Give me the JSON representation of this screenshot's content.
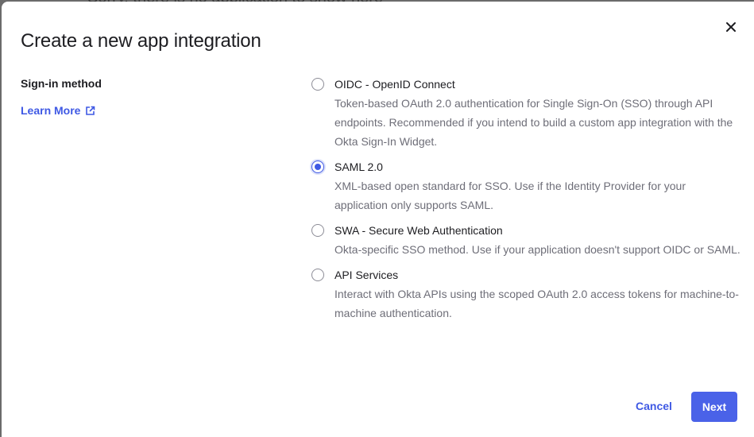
{
  "backdrop": {
    "text": "Sorry, there is no application to show here"
  },
  "dialog": {
    "title": "Create a new app integration",
    "section_label": "Sign-in method",
    "learn_more_label": "Learn More",
    "options": [
      {
        "label": "OIDC - OpenID Connect",
        "description": "Token-based OAuth 2.0 authentication for Single Sign-On (SSO) through API endpoints. Recommended if you intend to build a custom app integration with the Okta Sign-In Widget.",
        "selected": false
      },
      {
        "label": "SAML 2.0",
        "description": "XML-based open standard for SSO. Use if the Identity Provider for your application only supports SAML.",
        "selected": true
      },
      {
        "label": "SWA - Secure Web Authentication",
        "description": "Okta-specific SSO method. Use if your application doesn't support OIDC or SAML.",
        "selected": false
      },
      {
        "label": "API Services",
        "description": "Interact with Okta APIs using the scoped OAuth 2.0 access tokens for machine-to-machine authentication.",
        "selected": false
      }
    ],
    "cancel_label": "Cancel",
    "next_label": "Next"
  },
  "colors": {
    "accent": "#3f59e4",
    "primary_button": "#4a62e8"
  },
  "icons": {
    "close": "close-icon",
    "external_link": "external-link-icon"
  }
}
